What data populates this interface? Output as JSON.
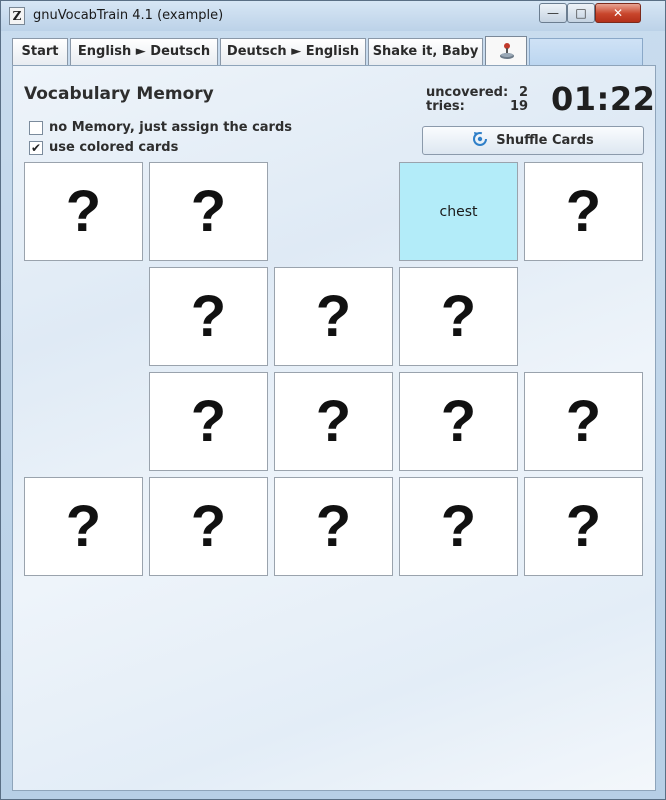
{
  "window": {
    "title": "gnuVocabTrain 4.1 (example)"
  },
  "tabs": [
    "Start",
    "English ► Deutsch",
    "Deutsch ► English",
    "Shake it, Baby"
  ],
  "active_tab_icon": "joystick-icon",
  "panel": {
    "heading": "Vocabulary Memory",
    "stats": {
      "uncovered_label": "uncovered:",
      "uncovered_value": "2",
      "tries_label": "tries:",
      "tries_value": "19"
    },
    "timer": "01:22",
    "options": [
      {
        "label": "no Memory, just assign the cards",
        "checked": false
      },
      {
        "label": "use colored cards",
        "checked": true
      }
    ],
    "shuffle_label": "Shuffle Cards"
  },
  "cards": [
    {
      "row": 0,
      "col": 0,
      "state": "hidden",
      "text": "?"
    },
    {
      "row": 0,
      "col": 1,
      "state": "hidden",
      "text": "?"
    },
    {
      "row": 0,
      "col": 3,
      "state": "flipped",
      "text": "chest"
    },
    {
      "row": 0,
      "col": 4,
      "state": "hidden",
      "text": "?"
    },
    {
      "row": 1,
      "col": 1,
      "state": "hidden",
      "text": "?"
    },
    {
      "row": 1,
      "col": 2,
      "state": "hidden",
      "text": "?"
    },
    {
      "row": 1,
      "col": 3,
      "state": "hidden",
      "text": "?"
    },
    {
      "row": 2,
      "col": 1,
      "state": "hidden",
      "text": "?"
    },
    {
      "row": 2,
      "col": 2,
      "state": "hidden",
      "text": "?"
    },
    {
      "row": 2,
      "col": 3,
      "state": "hidden",
      "text": "?"
    },
    {
      "row": 2,
      "col": 4,
      "state": "hidden",
      "text": "?"
    },
    {
      "row": 3,
      "col": 0,
      "state": "hidden",
      "text": "?"
    },
    {
      "row": 3,
      "col": 1,
      "state": "hidden",
      "text": "?"
    },
    {
      "row": 3,
      "col": 2,
      "state": "hidden",
      "text": "?"
    },
    {
      "row": 3,
      "col": 3,
      "state": "hidden",
      "text": "?"
    },
    {
      "row": 3,
      "col": 4,
      "state": "hidden",
      "text": "?"
    }
  ],
  "colors": {
    "flipped_card": "#b3ecf9",
    "close_button": "#c8452b"
  }
}
